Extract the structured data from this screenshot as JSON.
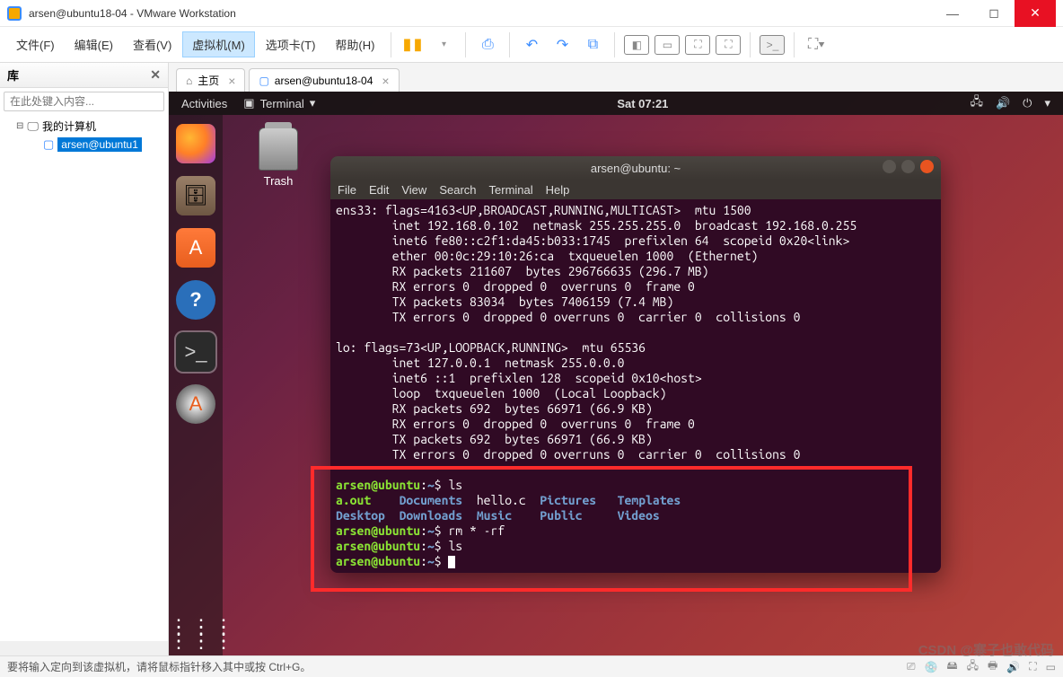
{
  "titlebar": {
    "title": "arsen@ubuntu18-04 - VMware Workstation"
  },
  "menubar": {
    "items": [
      "文件(F)",
      "编辑(E)",
      "查看(V)",
      "虚拟机(M)",
      "选项卡(T)",
      "帮助(H)"
    ],
    "active_index": 3
  },
  "sidebar": {
    "header": "库",
    "search_placeholder": "在此处键入内容...",
    "root": "我的计算机",
    "vm": "arsen@ubuntu1"
  },
  "tabs": {
    "home": "主页",
    "vm": "arsen@ubuntu18-04"
  },
  "ubuntu": {
    "topbar": {
      "activities": "Activities",
      "terminal_label": "Terminal",
      "clock": "Sat 07:21"
    },
    "trash_label": "Trash"
  },
  "terminal": {
    "title": "arsen@ubuntu: ~",
    "menu": [
      "File",
      "Edit",
      "View",
      "Search",
      "Terminal",
      "Help"
    ],
    "ifconfig_top": "ens33: flags=4163<UP,BROADCAST,RUNNING,MULTICAST>  mtu 1500\n        inet 192.168.0.102  netmask 255.255.255.0  broadcast 192.168.0.255\n        inet6 fe80::c2f1:da45:b033:1745  prefixlen 64  scopeid 0x20<link>\n        ether 00:0c:29:10:26:ca  txqueuelen 1000  (Ethernet)\n        RX packets 211607  bytes 296766635 (296.7 MB)\n        RX errors 0  dropped 0  overruns 0  frame 0\n        TX packets 83034  bytes 7406159 (7.4 MB)\n        TX errors 0  dropped 0 overruns 0  carrier 0  collisions 0\n\nlo: flags=73<UP,LOOPBACK,RUNNING>  mtu 65536\n        inet 127.0.0.1  netmask 255.0.0.0\n        inet6 ::1  prefixlen 128  scopeid 0x10<host>\n        loop  txqueuelen 1000  (Local Loopback)\n        RX packets 692  bytes 66971 (66.9 KB)\n        RX errors 0  dropped 0  overruns 0  frame 0\n        TX packets 692  bytes 66971 (66.9 KB)\n        TX errors 0  dropped 0 overruns 0  carrier 0  collisions 0\n",
    "prompt_user": "arsen@ubuntu",
    "prompt_path": "~",
    "cmd1": "ls",
    "ls_row1_green": "a.out",
    "ls_row1_blue": [
      "Documents",
      "Pictures",
      "Templates"
    ],
    "ls_row1_white": "hello.c",
    "ls_row2_blue": [
      "Desktop",
      "Downloads",
      "Music",
      "Public",
      "Videos"
    ],
    "cmd2": "rm * -rf",
    "cmd3": "ls"
  },
  "statusbar": {
    "text": "要将输入定向到该虚拟机，请将鼠标指针移入其中或按 Ctrl+G。"
  },
  "watermark": "CSDN @寨子也敢代码"
}
